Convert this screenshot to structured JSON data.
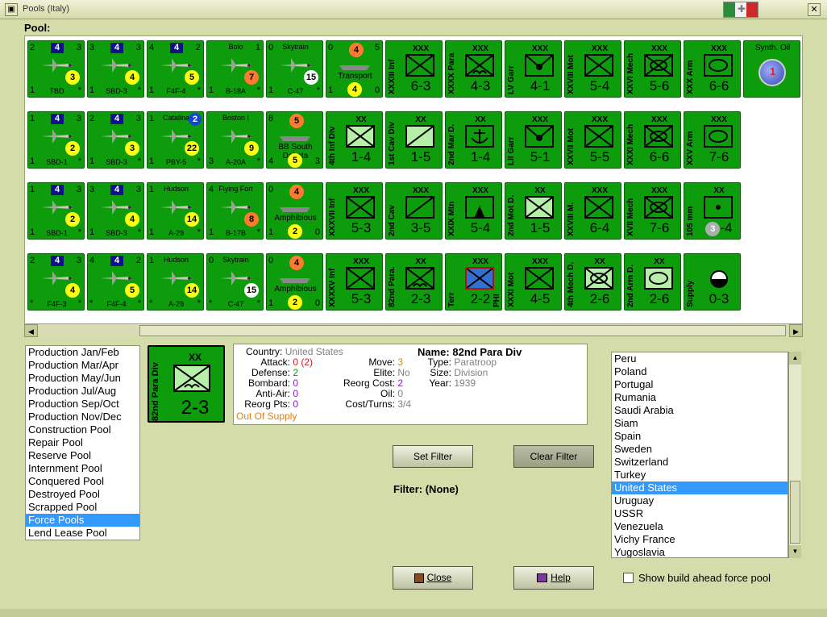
{
  "window": {
    "title": "Pools (Italy)"
  },
  "pool_label": "Pool:",
  "counters": [
    [
      {
        "type": "air",
        "tl": "2",
        "badge": "4",
        "tr": "3",
        "circle": "3",
        "circle_color": "yellow",
        "name": "TBD",
        "bl": "1",
        "br": "*"
      },
      {
        "type": "air",
        "tl": "3",
        "badge": "4",
        "tr": "3",
        "circle": "4",
        "circle_color": "yellow",
        "name": "SBD-3",
        "bl": "1",
        "br": "*"
      },
      {
        "type": "air",
        "tl": "4",
        "badge": "4",
        "tr": "2",
        "circle": "5",
        "circle_color": "yellow",
        "name": "F4F-4",
        "bl": "1",
        "br": "*"
      },
      {
        "type": "air",
        "tl": "",
        "badge": "",
        "tr": "1",
        "top_name": "Bolo",
        "circle": "7",
        "circle_color": "orange",
        "name": "B-18A",
        "bl": "1",
        "br": "*"
      },
      {
        "type": "air",
        "tl": "0",
        "badge": "",
        "tr": "",
        "top_name": "Skytrain",
        "circle": "15",
        "circle_color": "white",
        "name": "C-47",
        "bl": "1",
        "br": "*"
      },
      {
        "type": "naval",
        "tl": "0",
        "topcircle": "4",
        "tr": "5",
        "mid_name": "Transport",
        "circle": "4",
        "circle_color": "yellow",
        "bl": "1",
        "br": "0"
      },
      {
        "type": "land",
        "vert": "XXXIII Inf",
        "size": "XXX",
        "sym": "inf",
        "value": "6-3"
      },
      {
        "type": "land",
        "vert": "XXXX Para",
        "size": "XXX",
        "sym": "para",
        "value": "4-3"
      },
      {
        "type": "land",
        "vert": "LV Garr",
        "size": "XXX",
        "sym": "garr",
        "value": "4-1"
      },
      {
        "type": "land",
        "vert": "XXVIII Mot",
        "size": "XXX",
        "sym": "mot",
        "value": "5-4"
      },
      {
        "type": "land",
        "vert": "XXVI Mech",
        "size": "XXX",
        "sym": "mech",
        "value": "5-6"
      },
      {
        "type": "land",
        "vert": "XXX Arm",
        "size": "XXX",
        "sym": "arm",
        "value": "6-6"
      },
      {
        "type": "oil",
        "label": "Synth. Oil",
        "value": "1"
      }
    ],
    [
      {
        "type": "air",
        "tl": "1",
        "badge": "4",
        "tr": "3",
        "circle": "2",
        "circle_color": "yellow",
        "name": "SBD-1",
        "bl": "1",
        "br": "*"
      },
      {
        "type": "air",
        "tl": "2",
        "badge": "4",
        "tr": "3",
        "circle": "3",
        "circle_color": "yellow",
        "name": "SBD-3",
        "bl": "1",
        "br": "*"
      },
      {
        "type": "air",
        "tl": "1",
        "badge": "",
        "tr": "",
        "top_name": "Catalina",
        "topcircle_blue": "2",
        "circle": "22",
        "circle_color": "yellow",
        "name": "PBY-5",
        "bl": "1",
        "br": "*"
      },
      {
        "type": "air",
        "tl": "",
        "badge": "",
        "tr": "",
        "top_name": "Boston I",
        "circle": "9",
        "circle_color": "yellow",
        "name": "A-20A",
        "bl": "3",
        "br": "*"
      },
      {
        "type": "naval",
        "tl": "8",
        "topcircle": "5",
        "tr": "",
        "mid_name": "BB South Dakota",
        "circle": "5",
        "circle_color": "yellow",
        "bl": "4",
        "br": "3"
      },
      {
        "type": "land",
        "vert": "4th Inf Div",
        "size": "XX",
        "sym": "inf-light",
        "value": "1-4"
      },
      {
        "type": "land",
        "vert": "1st Cav Div",
        "size": "XX",
        "sym": "cav-light",
        "value": "1-5"
      },
      {
        "type": "land",
        "vert": "2nd Mar D.",
        "size": "XX",
        "sym": "mar",
        "value": "1-4"
      },
      {
        "type": "land",
        "vert": "LII Garr",
        "size": "XXX",
        "sym": "garr",
        "value": "5-1"
      },
      {
        "type": "land",
        "vert": "XXVII Mot",
        "size": "XXX",
        "sym": "mot",
        "value": "5-5"
      },
      {
        "type": "land",
        "vert": "XXXI Mech",
        "size": "XXX",
        "sym": "mech",
        "value": "6-6"
      },
      {
        "type": "land",
        "vert": "XXV Arm",
        "size": "XXX",
        "sym": "arm",
        "value": "7-6"
      }
    ],
    [
      {
        "type": "air",
        "tl": "1",
        "badge": "4",
        "tr": "3",
        "circle": "2",
        "circle_color": "yellow",
        "name": "SBD-1",
        "bl": "1",
        "br": "*"
      },
      {
        "type": "air",
        "tl": "3",
        "badge": "4",
        "tr": "3",
        "circle": "4",
        "circle_color": "yellow",
        "name": "SBD-3",
        "bl": "1",
        "br": "*"
      },
      {
        "type": "air",
        "tl": "1",
        "badge": "",
        "tr": "",
        "top_name": "Hudson",
        "circle": "14",
        "circle_color": "yellow",
        "name": "A-29",
        "bl": "1",
        "br": "*"
      },
      {
        "type": "air",
        "tl": "4",
        "badge": "",
        "tr": "",
        "top_name": "Flying Fort",
        "circle": "8",
        "circle_color": "orange",
        "name": "B-17B",
        "bl": "1",
        "br": "*"
      },
      {
        "type": "naval",
        "tl": "0",
        "topcircle": "4",
        "tr": "",
        "mid_name": "Amphibious",
        "circle": "2",
        "circle_color": "yellow",
        "bl": "1",
        "br": "0"
      },
      {
        "type": "land",
        "vert": "XXXVII Inf",
        "size": "XXX",
        "sym": "inf",
        "value": "5-3"
      },
      {
        "type": "land",
        "vert": "2nd Cav",
        "size": "XXX",
        "sym": "cav",
        "value": "3-5"
      },
      {
        "type": "land",
        "vert": "XXIX Mtn",
        "size": "XXX",
        "sym": "mtn",
        "value": "5-4"
      },
      {
        "type": "land",
        "vert": "2nd Mot D.",
        "size": "XX",
        "sym": "mot-light",
        "value": "1-5"
      },
      {
        "type": "land",
        "vert": "XXVIII M.",
        "size": "XXX",
        "sym": "mot",
        "value": "6-4"
      },
      {
        "type": "land",
        "vert": "XVII Mech",
        "size": "XXX",
        "sym": "mech",
        "value": "7-6"
      },
      {
        "type": "land",
        "vert": "105 mm",
        "size": "XX",
        "sym": "art",
        "value_circle": "3",
        "value": "-4"
      }
    ],
    [
      {
        "type": "air",
        "tl": "2",
        "badge": "4",
        "tr": "3",
        "circle": "4",
        "circle_color": "yellow",
        "name": "F4F-3",
        "bl": "*",
        "br": "*"
      },
      {
        "type": "air",
        "tl": "4",
        "badge": "4",
        "tr": "2",
        "circle": "5",
        "circle_color": "yellow",
        "name": "F4F-4",
        "bl": "*",
        "br": "*"
      },
      {
        "type": "air",
        "tl": "1",
        "badge": "",
        "tr": "",
        "top_name": "Hudson",
        "circle": "14",
        "circle_color": "yellow",
        "name": "A-29",
        "bl": "*",
        "br": "*"
      },
      {
        "type": "air",
        "tl": "0",
        "badge": "",
        "tr": "",
        "top_name": "Skytrain",
        "circle": "15",
        "circle_color": "white",
        "name": "C-47",
        "bl": "*",
        "br": "*"
      },
      {
        "type": "naval",
        "tl": "0",
        "topcircle": "4",
        "tr": "",
        "mid_name": "Amphibious",
        "circle": "2",
        "circle_color": "yellow",
        "bl": "1",
        "br": "0"
      },
      {
        "type": "land",
        "vert": "XXXXV Inf",
        "size": "XXX",
        "sym": "inf",
        "value": "5-3"
      },
      {
        "type": "land",
        "vert": "82nd Para.",
        "size": "XX",
        "sym": "para",
        "value": "2-3"
      },
      {
        "type": "land",
        "vert": "Terr",
        "size": "XXX",
        "sym": "terr",
        "right_vert": "PHI",
        "value": "2-2"
      },
      {
        "type": "land",
        "vert": "XXXI Mot",
        "size": "XXX",
        "sym": "mot",
        "value": "4-5"
      },
      {
        "type": "land",
        "vert": "4th Mech D.",
        "size": "XX",
        "sym": "mech-light",
        "value": "2-6"
      },
      {
        "type": "land",
        "vert": "2nd Arm D.",
        "size": "XX",
        "sym": "arm-light",
        "value": "2-6"
      },
      {
        "type": "land",
        "vert": "Supply",
        "size": "",
        "sym": "supply",
        "value": "0-3"
      }
    ]
  ],
  "pool_list": {
    "items": [
      "Production Jan/Feb",
      "Production Mar/Apr",
      "Production May/Jun",
      "Production Jul/Aug",
      "Production Sep/Oct",
      "Production Nov/Dec",
      "Construction Pool",
      "Repair Pool",
      "Reserve Pool",
      "Internment Pool",
      "Conquered Pool",
      "Destroyed Pool",
      "Scrapped Pool",
      "Force Pools",
      "Lend Lease Pool"
    ],
    "selected": "Force Pools"
  },
  "selected_unit": {
    "vert": "82nd Para Div",
    "size": "XX",
    "value": "2-3"
  },
  "info": {
    "country_label": "Country:",
    "country": "United States",
    "attack_label": "Attack:",
    "attack": "0",
    "attack_extra": "(2)",
    "defense_label": "Defense:",
    "defense": "2",
    "bombard_label": "Bombard:",
    "bombard": "0",
    "antiair_label": "Anti-Air:",
    "antiair": "0",
    "reorg_pts_label": "Reorg Pts:",
    "reorg_pts": "0",
    "supply_status": "Out Of Supply",
    "move_label": "Move:",
    "move": "3",
    "elite_label": "Elite:",
    "elite": "No",
    "reorg_cost_label": "Reorg Cost:",
    "reorg_cost": "2",
    "oil_label": "Oil:",
    "oil": "0",
    "cost_turns_label": "Cost/Turns:",
    "cost_turns": "3/4",
    "name_label": "Name:",
    "name": "82nd Para Div",
    "type_label": "Type:",
    "type": "Paratroop",
    "size_label": "Size:",
    "size": "Division",
    "year_label": "Year:",
    "year": "1939"
  },
  "buttons": {
    "set_filter": "Set Filter",
    "clear_filter": "Clear Filter",
    "close": "Close",
    "help": "Help"
  },
  "filter_text": "Filter: (None)",
  "country_list": {
    "items": [
      "Peru",
      "Poland",
      "Portugal",
      "Rumania",
      "Saudi Arabia",
      "Siam",
      "Spain",
      "Sweden",
      "Switzerland",
      "Turkey",
      "United States",
      "Uruguay",
      "USSR",
      "Venezuela",
      "Vichy France",
      "Yugoslavia"
    ],
    "selected": "United States"
  },
  "show_build_ahead": "Show build ahead force pool"
}
